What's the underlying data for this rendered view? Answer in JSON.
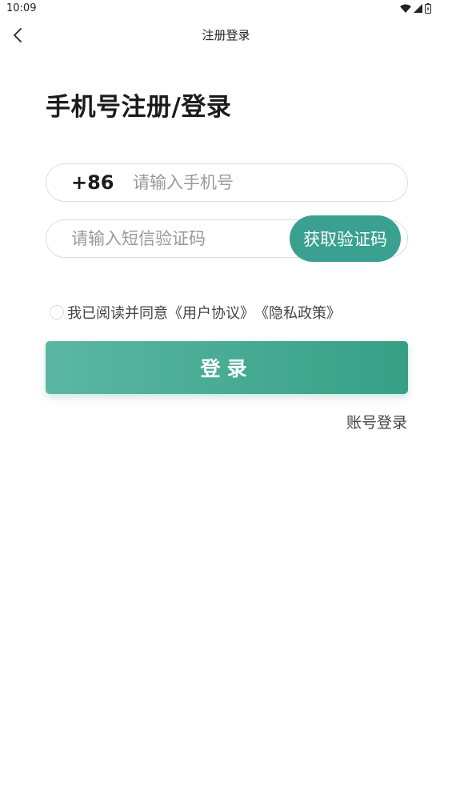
{
  "status_bar": {
    "time": "10:09",
    "icons": [
      "wifi-icon",
      "signal-icon",
      "battery-icon"
    ]
  },
  "nav": {
    "back_icon": "chevron-left-icon",
    "title": "注册登录"
  },
  "heading": "手机号注册/登录",
  "phone": {
    "country_code": "+86",
    "placeholder": "请输入手机号",
    "value": ""
  },
  "code": {
    "placeholder": "请输入短信验证码",
    "value": "",
    "get_code_label": "获取验证码"
  },
  "agreement": {
    "checked": false,
    "prefix": "我已阅读并同意",
    "user_agreement": "《用户协议》",
    "privacy_policy": "《隐私政策》"
  },
  "login_label": "登录",
  "account_login_label": "账号登录",
  "colors": {
    "accent": "#3aa090",
    "button_gradient_start": "#5bb7a2",
    "button_gradient_end": "#36a085"
  }
}
